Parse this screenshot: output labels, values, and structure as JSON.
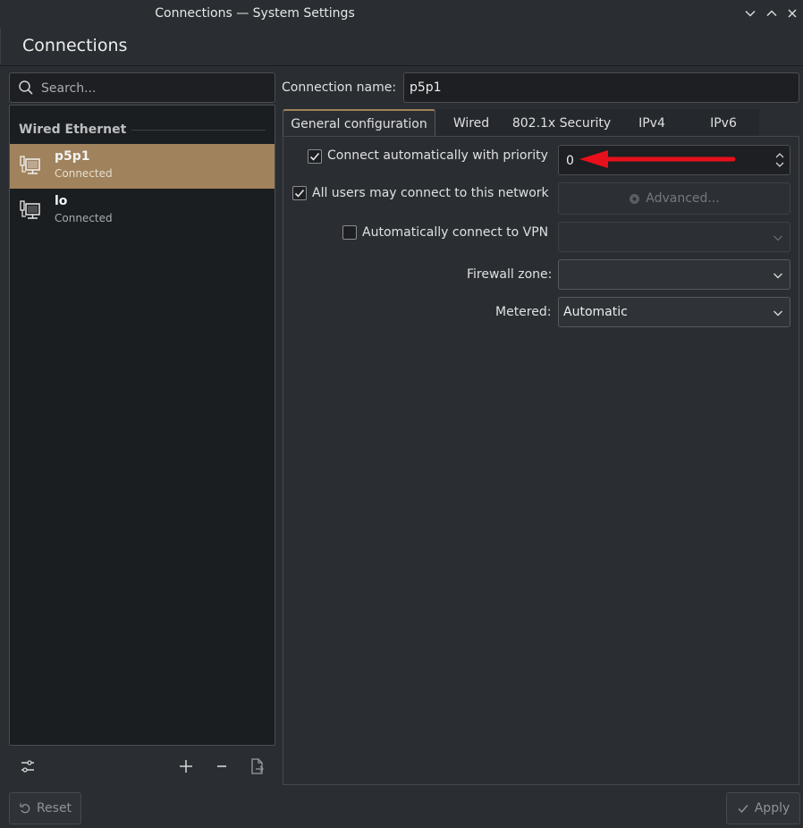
{
  "window": {
    "title": "Connections — System Settings"
  },
  "page": {
    "title": "Connections"
  },
  "search": {
    "placeholder": "Search..."
  },
  "connections": {
    "section": "Wired Ethernet",
    "items": [
      {
        "name": "p5p1",
        "status": "Connected",
        "selected": true
      },
      {
        "name": "lo",
        "status": "Connected",
        "selected": false
      }
    ]
  },
  "footer": {
    "reset_label": "Reset",
    "apply_label": "Apply"
  },
  "editor": {
    "connection_name_label": "Connection name:",
    "connection_name_value": "p5p1",
    "tabs": [
      {
        "label": "General configuration",
        "active": true
      },
      {
        "label": "Wired",
        "active": false
      },
      {
        "label": "802.1x Security",
        "active": false
      },
      {
        "label": "IPv4",
        "active": false
      },
      {
        "label": "IPv6",
        "active": false
      }
    ],
    "general": {
      "auto_connect_label": "Connect automatically with priority",
      "auto_connect_checked": true,
      "priority_value": "0",
      "all_users_label": "All users may connect to this network",
      "all_users_checked": true,
      "advanced_label": "Advanced...",
      "vpn_label": "Automatically connect to VPN",
      "vpn_checked": false,
      "vpn_value": "",
      "firewall_label": "Firewall zone:",
      "firewall_value": "",
      "metered_label": "Metered:",
      "metered_value": "Automatic"
    }
  },
  "colors": {
    "accent": "#a0825c",
    "annotation_arrow": "#e8101a",
    "background": "#2a2e32"
  }
}
